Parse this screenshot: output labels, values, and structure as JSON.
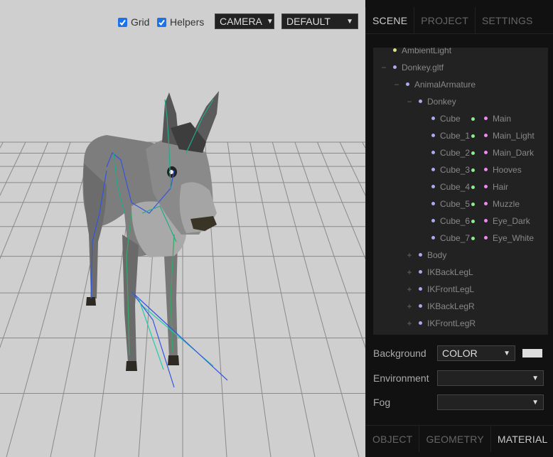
{
  "viewport": {
    "grid_label": "Grid",
    "helpers_label": "Helpers",
    "camera_select": "CAMERA",
    "shading_select": "DEFAULT"
  },
  "sidebar": {
    "tabs": [
      "SCENE",
      "PROJECT",
      "SETTINGS"
    ],
    "active_tab": "SCENE",
    "outliner": [
      {
        "label": "AmbientLight",
        "indent": 0,
        "opener": "",
        "type": "light"
      },
      {
        "label": "Donkey.gltf",
        "indent": 0,
        "opener": "−",
        "type": "obj"
      },
      {
        "label": "AnimalArmature",
        "indent": 1,
        "opener": "−",
        "type": "obj"
      },
      {
        "label": "Donkey",
        "indent": 2,
        "opener": "−",
        "type": "obj"
      },
      {
        "label": "Cube",
        "indent": 3,
        "opener": "",
        "type": "obj",
        "material": "Main"
      },
      {
        "label": "Cube_1",
        "indent": 3,
        "opener": "",
        "type": "obj",
        "material": "Main_Light"
      },
      {
        "label": "Cube_2",
        "indent": 3,
        "opener": "",
        "type": "obj",
        "material": "Main_Dark"
      },
      {
        "label": "Cube_3",
        "indent": 3,
        "opener": "",
        "type": "obj",
        "material": "Hooves"
      },
      {
        "label": "Cube_4",
        "indent": 3,
        "opener": "",
        "type": "obj",
        "material": "Hair"
      },
      {
        "label": "Cube_5",
        "indent": 3,
        "opener": "",
        "type": "obj",
        "material": "Muzzle"
      },
      {
        "label": "Cube_6",
        "indent": 3,
        "opener": "",
        "type": "obj",
        "material": "Eye_Dark"
      },
      {
        "label": "Cube_7",
        "indent": 3,
        "opener": "",
        "type": "obj",
        "material": "Eye_White"
      },
      {
        "label": "Body",
        "indent": 2,
        "opener": "+",
        "type": "obj"
      },
      {
        "label": "IKBackLegL",
        "indent": 2,
        "opener": "+",
        "type": "obj"
      },
      {
        "label": "IKFrontLegL",
        "indent": 2,
        "opener": "+",
        "type": "obj"
      },
      {
        "label": "IKBackLegR",
        "indent": 2,
        "opener": "+",
        "type": "obj"
      },
      {
        "label": "IKFrontLegR",
        "indent": 2,
        "opener": "+",
        "type": "obj"
      }
    ],
    "background_label": "Background",
    "background_select": "COLOR",
    "background_color": "#dddddd",
    "environment_label": "Environment",
    "environment_select": "",
    "fog_label": "Fog",
    "fog_select": "",
    "bottom_tabs": [
      "OBJECT",
      "GEOMETRY",
      "MATERIAL"
    ],
    "active_bottom_tab": "MATERIAL"
  }
}
